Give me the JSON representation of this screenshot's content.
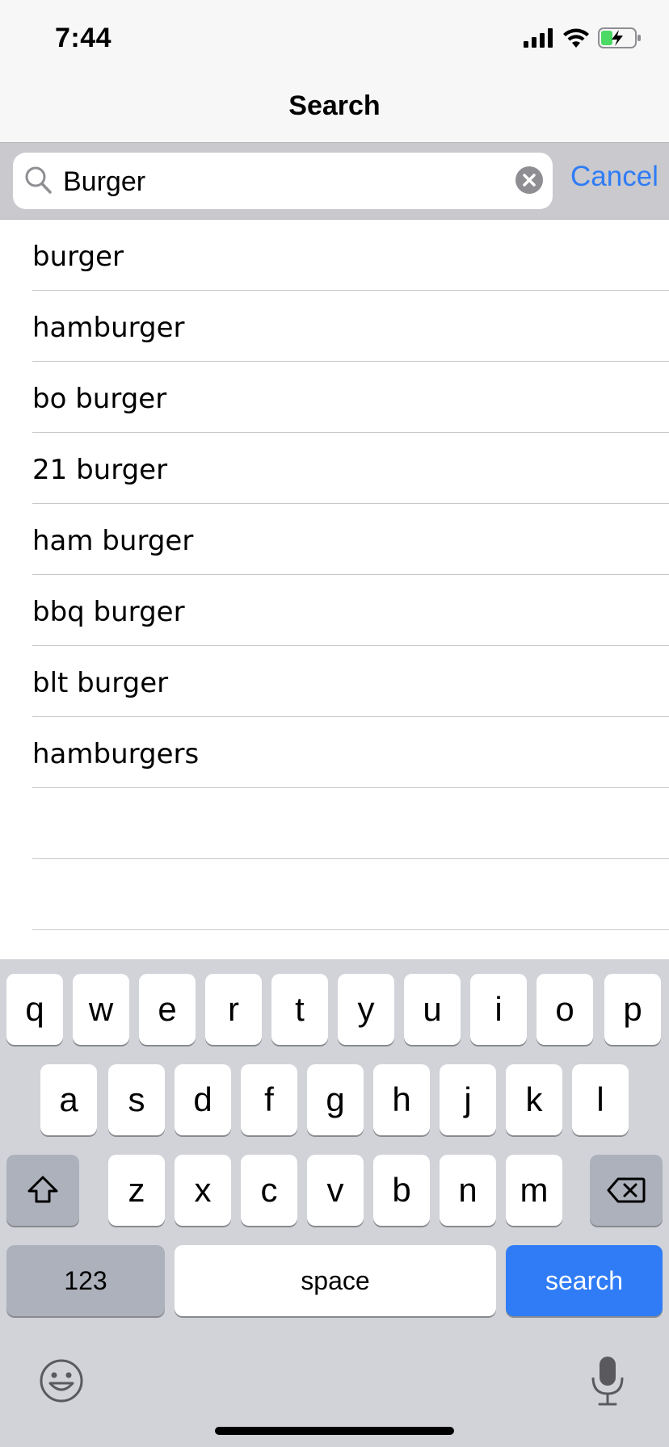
{
  "status_bar": {
    "time": "7:44"
  },
  "nav": {
    "title": "Search"
  },
  "search": {
    "value": "Burger",
    "cancel_label": "Cancel"
  },
  "suggestions": [
    "burger",
    "hamburger",
    "bo burger",
    "21 burger",
    "ham burger",
    "bbq burger",
    "blt burger",
    "hamburgers",
    "",
    ""
  ],
  "keyboard": {
    "row1": [
      "q",
      "w",
      "e",
      "r",
      "t",
      "y",
      "u",
      "i",
      "o",
      "p"
    ],
    "row2": [
      "a",
      "s",
      "d",
      "f",
      "g",
      "h",
      "j",
      "k",
      "l"
    ],
    "row3": [
      "z",
      "x",
      "c",
      "v",
      "b",
      "n",
      "m"
    ],
    "numbers_label": "123",
    "space_label": "space",
    "search_label": "search"
  },
  "colors": {
    "accent": "#2f7cf6",
    "battery": "#4cd964"
  }
}
